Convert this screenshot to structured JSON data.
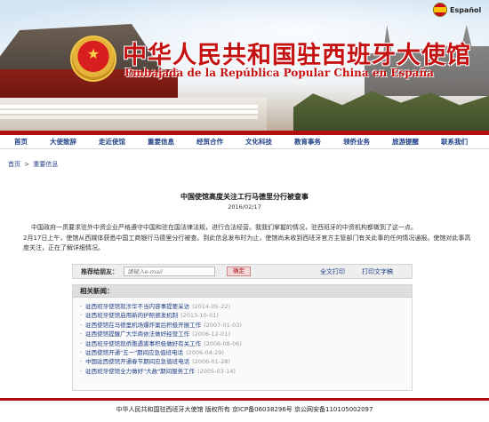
{
  "header": {
    "title_cn": "中华人民共和国驻西班牙大使馆",
    "title_es": "Embajada de la República Popular China en España",
    "language_link": "Español"
  },
  "nav": {
    "items": [
      "首页",
      "大使致辞",
      "走近使馆",
      "重要信息",
      "经贸合作",
      "文化科技",
      "教育事务",
      "领侨业务",
      "旅游提醒",
      "联系我们"
    ]
  },
  "breadcrumb": {
    "home": "首页",
    "separator": ">",
    "current": "重要信息"
  },
  "article": {
    "title": "中国使馆高度关注工行马德里分行被查事",
    "date": "2016/02/17",
    "paragraphs": [
      "中国政府一贯要求驻外中资企业严格遵守中国和驻在国法律法规，进行合法经营。我我们掌握的情况，驻西班牙的中资机构都做到了这一点。",
      "2月17日上午，使馆从西媒体获悉中国工商银行马德里分行被查。到此信息发布时为止，使馆尚未收到西班牙官方主管部门有关此事的任何情况通报。使馆对此事高度关注，正在了解详细情况。"
    ]
  },
  "share": {
    "label": "推荐给朋友：",
    "email_placeholder": "请输入e-mail",
    "ok_button": "确定",
    "print_full": "全文打印",
    "print_text": "打印文字稿"
  },
  "related": {
    "heading": "相关新闻：",
    "items": [
      {
        "title": "驻西班牙使馆就涉华不当内容事提要采访",
        "date": "(2014-05-22)"
      },
      {
        "title": "驻西班牙使馆启用新的护照颁发机制",
        "date": "(2013-10-01)"
      },
      {
        "title": "驻西使馆在马德里机场爆炸案后积极开展工作",
        "date": "(2007-01-03)"
      },
      {
        "title": "驻西使馆提醒广大华商依法做好经营工作",
        "date": "(2006-12-01)"
      },
      {
        "title": "驻西班牙使馆就侨胞遇害事积极做好有关工作",
        "date": "(2006-08-06)"
      },
      {
        "title": "驻西使馆开通\"五一\"期间应急值班电话",
        "date": "(2006-04-29)"
      },
      {
        "title": "中国驻西使馆开通春节期间应急值班电话",
        "date": "(2006-01-28)"
      },
      {
        "title": "驻西班牙使馆全力做好\"大赦\"期间服务工作",
        "date": "(2005-03-14)"
      }
    ]
  },
  "footer": {
    "text": "中华人民共和国驻西班牙大使馆 版权所有 京ICP备06038296号 京公网安备110105002097"
  },
  "colors": {
    "accent_red": "#b30f0f",
    "link_blue": "#1f3f86"
  }
}
